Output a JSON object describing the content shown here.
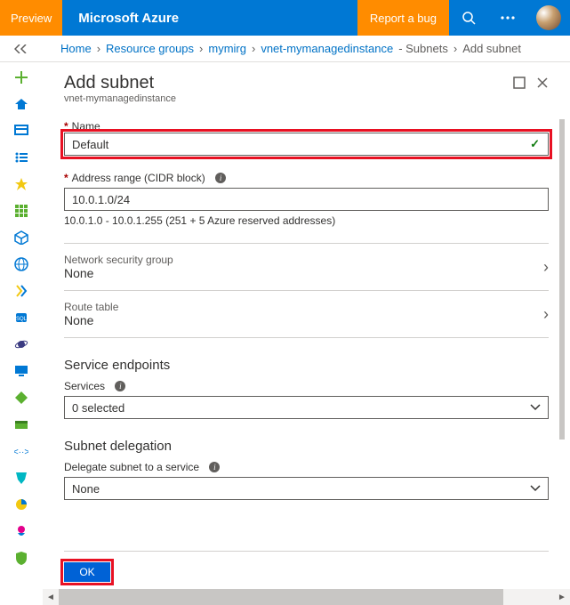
{
  "topbar": {
    "preview": "Preview",
    "brand": "Microsoft Azure",
    "report": "Report a bug"
  },
  "breadcrumb": {
    "items": [
      "Home",
      "Resource groups",
      "mymirg",
      "vnet-mymanagedinstance",
      "- Subnets",
      "Add subnet"
    ]
  },
  "blade": {
    "title": "Add subnet",
    "subtitle": "vnet-mymanagedinstance"
  },
  "form": {
    "name_label": "Name",
    "name_value": "Default",
    "addr_label": "Address range (CIDR block)",
    "addr_value": "10.0.1.0/24",
    "addr_hint": "10.0.1.0 - 10.0.1.255 (251 + 5 Azure reserved addresses)",
    "nsg_label": "Network security group",
    "nsg_value": "None",
    "rt_label": "Route table",
    "rt_value": "None",
    "se_title": "Service endpoints",
    "se_services_label": "Services",
    "se_services_value": "0 selected",
    "sd_title": "Subnet delegation",
    "sd_label": "Delegate subnet to a service",
    "sd_value": "None",
    "ok": "OK"
  }
}
